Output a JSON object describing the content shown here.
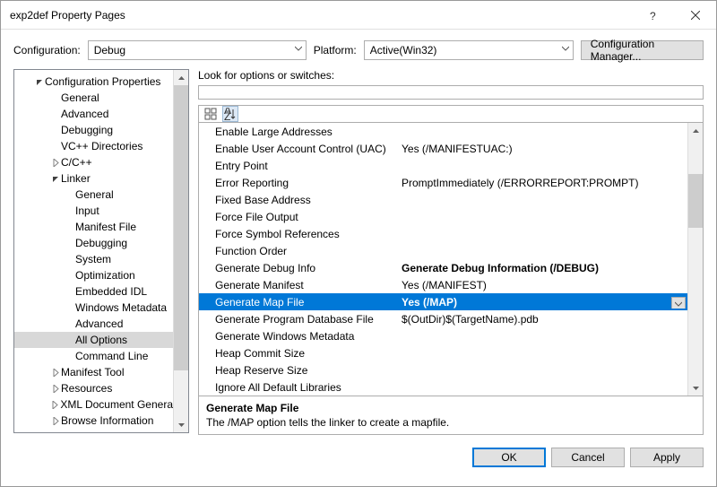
{
  "titlebar": {
    "title": "exp2def Property Pages"
  },
  "config": {
    "label": "Configuration:",
    "value": "Debug",
    "platform_label": "Platform:",
    "platform_value": "Active(Win32)",
    "manager_btn": "Configuration Manager..."
  },
  "tree": {
    "root": "Configuration Properties",
    "items": [
      {
        "label": "General",
        "indent": 2
      },
      {
        "label": "Advanced",
        "indent": 2
      },
      {
        "label": "Debugging",
        "indent": 2
      },
      {
        "label": "VC++ Directories",
        "indent": 2
      },
      {
        "label": "C/C++",
        "indent": 2,
        "expand": "closed"
      },
      {
        "label": "Linker",
        "indent": 2,
        "expand": "open"
      },
      {
        "label": "General",
        "indent": 3
      },
      {
        "label": "Input",
        "indent": 3
      },
      {
        "label": "Manifest File",
        "indent": 3
      },
      {
        "label": "Debugging",
        "indent": 3
      },
      {
        "label": "System",
        "indent": 3
      },
      {
        "label": "Optimization",
        "indent": 3
      },
      {
        "label": "Embedded IDL",
        "indent": 3
      },
      {
        "label": "Windows Metadata",
        "indent": 3
      },
      {
        "label": "Advanced",
        "indent": 3
      },
      {
        "label": "All Options",
        "indent": 3,
        "selected": true
      },
      {
        "label": "Command Line",
        "indent": 3
      },
      {
        "label": "Manifest Tool",
        "indent": 2,
        "expand": "closed"
      },
      {
        "label": "Resources",
        "indent": 2,
        "expand": "closed"
      },
      {
        "label": "XML Document Genera",
        "indent": 2,
        "expand": "closed"
      },
      {
        "label": "Browse Information",
        "indent": 2,
        "expand": "closed"
      }
    ]
  },
  "search": {
    "label": "Look for options or switches:"
  },
  "grid": {
    "rows": [
      {
        "name": "Enable Large Addresses",
        "value": ""
      },
      {
        "name": "Enable User Account Control (UAC)",
        "value": "Yes (/MANIFESTUAC:)"
      },
      {
        "name": "Entry Point",
        "value": ""
      },
      {
        "name": "Error Reporting",
        "value": "PromptImmediately (/ERRORREPORT:PROMPT)"
      },
      {
        "name": "Fixed Base Address",
        "value": ""
      },
      {
        "name": "Force File Output",
        "value": ""
      },
      {
        "name": "Force Symbol References",
        "value": ""
      },
      {
        "name": "Function Order",
        "value": ""
      },
      {
        "name": "Generate Debug Info",
        "value": "Generate Debug Information (/DEBUG)",
        "bold": true
      },
      {
        "name": "Generate Manifest",
        "value": "Yes (/MANIFEST)"
      },
      {
        "name": "Generate Map File",
        "value": "Yes (/MAP)",
        "selected": true,
        "boldval": true
      },
      {
        "name": "Generate Program Database File",
        "value": "$(OutDir)$(TargetName).pdb"
      },
      {
        "name": "Generate Windows Metadata",
        "value": ""
      },
      {
        "name": "Heap Commit Size",
        "value": ""
      },
      {
        "name": "Heap Reserve Size",
        "value": ""
      },
      {
        "name": "Ignore All Default Libraries",
        "value": ""
      }
    ]
  },
  "desc": {
    "title": "Generate Map File",
    "body": "The /MAP option tells the linker to create a mapfile."
  },
  "footer": {
    "ok": "OK",
    "cancel": "Cancel",
    "apply": "Apply"
  }
}
